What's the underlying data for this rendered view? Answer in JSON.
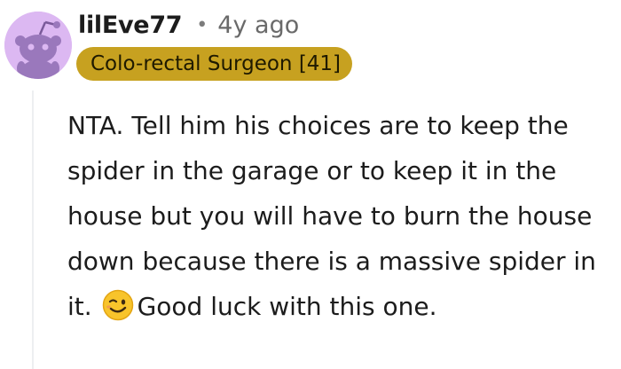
{
  "comment": {
    "author": "lilEve77",
    "separator": "•",
    "timestamp": "4y ago",
    "flair": "Colo-rectal Surgeon [41]",
    "avatar_color": "#dcb8f2",
    "flair_color": "#c7a120",
    "body_before_emoji": "NTA. Tell him his choices are to keep the spider in the garage or to keep it in the house but you will have to burn the house down because there is a massive spider in it.",
    "emoji": "winking-face",
    "body_after_emoji": "Good luck with this one."
  }
}
